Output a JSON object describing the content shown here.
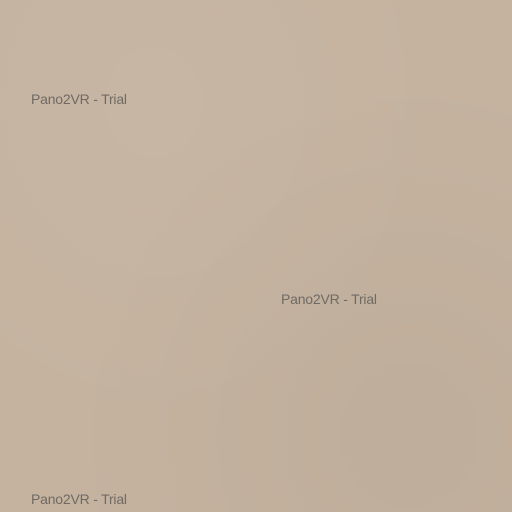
{
  "colors": {
    "background": "#C5B3A0",
    "watermark_text": "#6F6A64"
  },
  "watermarks": [
    {
      "text": "Pano2VR - Trial"
    },
    {
      "text": "Pano2VR - Trial"
    },
    {
      "text": "Pano2VR - Trial"
    }
  ]
}
